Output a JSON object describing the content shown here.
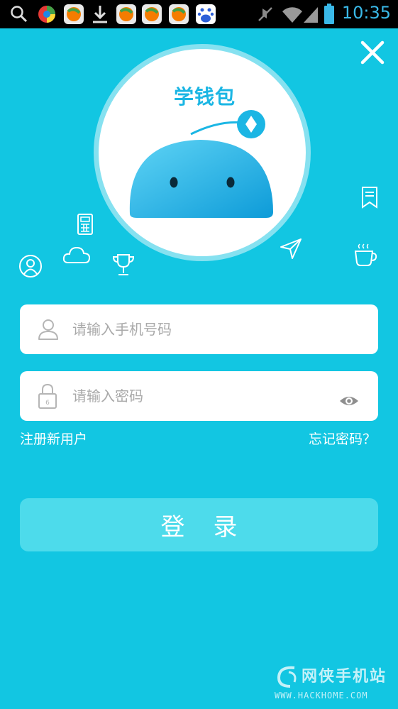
{
  "status_bar": {
    "time": "10:35",
    "icons": [
      "search-icon",
      "browser-icon",
      "app-icon",
      "download-icon",
      "app-icon",
      "app-icon",
      "app-icon",
      "baidu-icon",
      "mute-icon",
      "wifi-icon",
      "signal-icon",
      "battery-icon"
    ]
  },
  "logo": {
    "title": "学钱包"
  },
  "login_form": {
    "phone_placeholder": "请输入手机号码",
    "password_placeholder": "请输入密码",
    "register_label": "注册新用户",
    "forgot_label": "忘记密码？",
    "login_label": "登录"
  },
  "watermark": {
    "title": "网侠手机站",
    "url": "WWW.HACKHOME.COM"
  },
  "colors": {
    "background": "#12c6e2",
    "logo_blue": "#1bb6e4",
    "button": "#4ddbeb"
  }
}
